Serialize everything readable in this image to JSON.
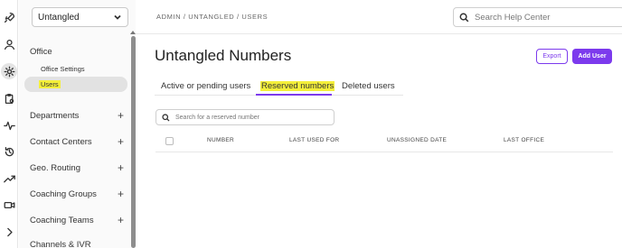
{
  "rail": {
    "icons": [
      "rocket-icon",
      "person-icon",
      "gear-icon",
      "clipboard-gear-icon",
      "pulse-icon",
      "history-icon",
      "trending-icon",
      "video-icon",
      "chevron-right-icon"
    ]
  },
  "sidebar": {
    "office_select": "Untangled",
    "section_label": "Office",
    "sub_items": {
      "office_settings": "Office Settings",
      "users": "Users"
    },
    "groups": [
      "Departments",
      "Contact Centers",
      "Geo. Routing",
      "Coaching Groups",
      "Coaching Teams",
      "Channels & IVR"
    ],
    "plus": "+"
  },
  "header": {
    "breadcrumb": "ADMIN / UNTANGLED / USERS",
    "help_search_placeholder": "Search Help Center"
  },
  "main": {
    "title": "Untangled Numbers",
    "export_label": "Export",
    "add_user_label": "Add User",
    "tabs": [
      {
        "label": "Active or pending users"
      },
      {
        "label": "Reserved numbers"
      },
      {
        "label": "Deleted users"
      }
    ],
    "table_search_placeholder": "Search for a reserved number",
    "columns": [
      "NUMBER",
      "LAST USED FOR",
      "UNASSIGNED DATE",
      "LAST OFFICE"
    ]
  },
  "colors": {
    "accent": "#7c3aed",
    "highlight": "#f4ef3a"
  }
}
